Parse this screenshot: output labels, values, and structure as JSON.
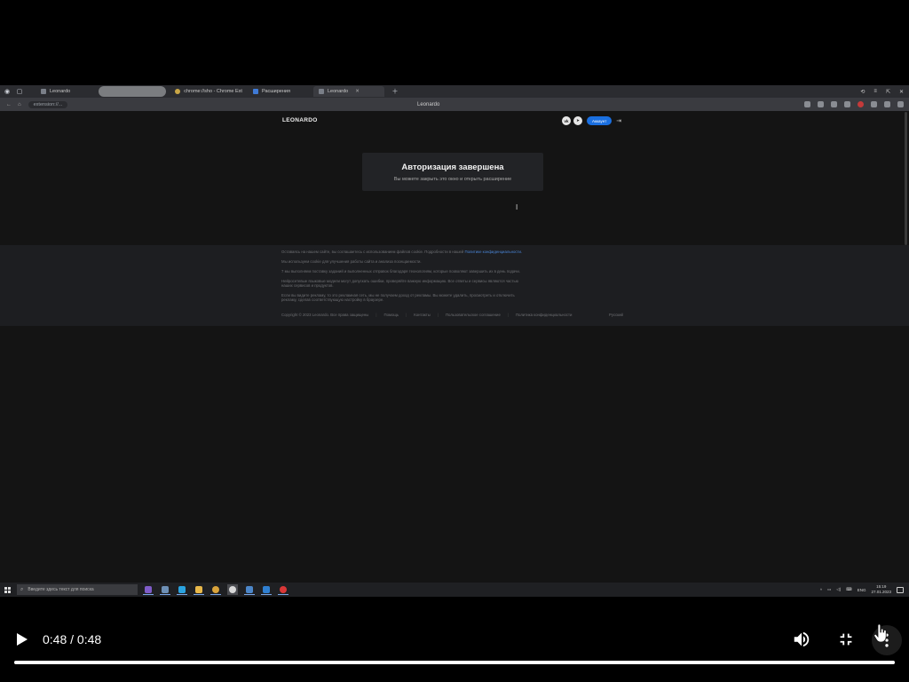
{
  "browser": {
    "tabs": [
      {
        "label": "Leonardo",
        "state": "inactive"
      },
      {
        "label": "",
        "state": "blank"
      },
      {
        "label": "chrome://sho - Chrome Ext",
        "state": "inactive"
      },
      {
        "label": "Расширения",
        "state": "inactive"
      },
      {
        "label": "Leonardo",
        "state": "active"
      }
    ],
    "window_controls": [
      "⟲",
      "≡",
      "⇱",
      "✕"
    ],
    "url": "extension://...",
    "page_title": "Leonardo"
  },
  "site": {
    "logo": "LEONARDO",
    "social": [
      "vk",
      "tg"
    ],
    "account_button": "Аккаунт",
    "auth": {
      "title": "Авторизация завершена",
      "subtitle": "Вы можете закрыть это окно и открыть расширение"
    },
    "footer": {
      "lines": [
        {
          "text": "Оставаясь на нашем сайте, вы соглашаетесь с использованием файлов cookie. Подробности в нашей ",
          "link": "Политике конфиденциальности."
        },
        {
          "text": "Мы используем cookie для улучшения работы сайта и анализа посещаемости.",
          "link": ""
        },
        {
          "text": "7 мы выполняем поставку заданий и выполненных отправок благодаря технологиям, которые позволяют завершить их в день подачи.",
          "link": ""
        },
        {
          "text": "Нейросетевые языковые модели могут допускать ошибки, проверяйте важную информацию. Все ответы и сервисы являются частью",
          "link": ""
        },
        {
          "text": "наших сервисов и продуктов.",
          "link": ""
        },
        {
          "text": "Если вы видите рекламу, то это рекламная сеть, мы не получаем доход от рекламы. Вы можете удалить, просмотреть и отключить",
          "link": ""
        },
        {
          "text": "рекламу, сделав соответствующую настройку в браузере.",
          "link": ""
        }
      ],
      "copyright": "Copyright © 2023 Leonardo. Все права защищены",
      "links": [
        "Помощь",
        "Контакты",
        "Пользовательское соглашение",
        "Политика конфиденциальности"
      ],
      "language": "Русский"
    }
  },
  "taskbar": {
    "search_placeholder": "Введите здесь текст для поиска",
    "apps": [
      {
        "name": "app-viber",
        "color": "#7f5cc8"
      },
      {
        "name": "app-monitor",
        "color": "#6d8fb5"
      },
      {
        "name": "app-telegram",
        "color": "#2aa3e0"
      },
      {
        "name": "app-explorer",
        "color": "#e8b84a"
      },
      {
        "name": "app-chrome",
        "color": "#d9a33b"
      },
      {
        "name": "app-yandex",
        "color": "#d8d8d8"
      },
      {
        "name": "app-photos",
        "color": "#4c86c9"
      },
      {
        "name": "app-vscode",
        "color": "#2f7fd1"
      },
      {
        "name": "app-opera",
        "color": "#d93737"
      }
    ],
    "tray": {
      "language": "ENG",
      "time": "15:19",
      "date": "27.01.2023"
    }
  },
  "video": {
    "time_display": "0:48 / 0:48",
    "progress": 1.0
  },
  "colors": {
    "accent": "#1a6fe0",
    "link": "#4a86d8"
  }
}
